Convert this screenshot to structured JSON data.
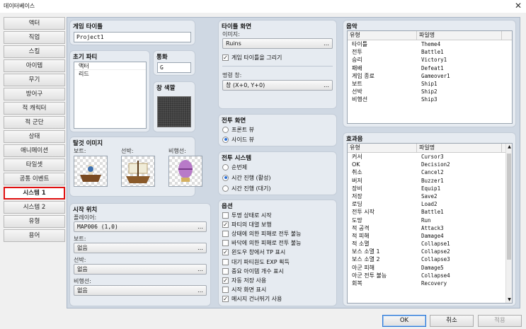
{
  "window": {
    "title": "데이터베이스"
  },
  "sidebar": {
    "items": [
      {
        "label": "액터"
      },
      {
        "label": "직업"
      },
      {
        "label": "스킬"
      },
      {
        "label": "아이템"
      },
      {
        "label": "무기"
      },
      {
        "label": "방어구"
      },
      {
        "label": "적 캐릭터"
      },
      {
        "label": "적 군단"
      },
      {
        "label": "상태"
      },
      {
        "label": "애니메이션"
      },
      {
        "label": "타일셋"
      },
      {
        "label": "공통 이벤트"
      },
      {
        "label": "시스템 1"
      },
      {
        "label": "시스템 2"
      },
      {
        "label": "유형"
      },
      {
        "label": "용어"
      }
    ],
    "selected": "시스템 1"
  },
  "game_title": {
    "label": "게임 타이틀",
    "value": "Project1"
  },
  "party": {
    "label": "초기 파티",
    "members": [
      "액터",
      "리드"
    ]
  },
  "currency": {
    "label": "통화",
    "value": "G"
  },
  "window_color": {
    "label": "창 색깔"
  },
  "vehicle_images": {
    "label": "탈것 이미지",
    "boat": "보트:",
    "ship": "선박:",
    "airship": "비행선:"
  },
  "start_position": {
    "label": "시작 위치",
    "player_label": "플레이어:",
    "player_value": "MAP006 (1,0)",
    "boat_label": "보트:",
    "boat_value": "없음",
    "ship_label": "선박:",
    "ship_value": "없음",
    "airship_label": "비행선:",
    "airship_value": "없음"
  },
  "title_screen": {
    "label": "타이틀 화면",
    "image_label": "이미지:",
    "image_value": "Ruins",
    "draw_title": "게임 타이틀을 그리기",
    "command_label": "명령 창:",
    "command_value": "창 (X+0, Y+0)"
  },
  "battle_screen": {
    "label": "전투 화면",
    "front": "프론트 뷰",
    "side": "사이드 뷰"
  },
  "battle_system": {
    "label": "전투 시스템",
    "turn": "순번제",
    "active": "시간 진행 (활성)",
    "wait": "시간 진행 (대기)"
  },
  "options": {
    "label": "옵션",
    "items": [
      {
        "label": "투명 상태로 시작",
        "checked": false
      },
      {
        "label": "파티의 대열 보행",
        "checked": true
      },
      {
        "label": "상태에 의한 피해로 전투 불능",
        "checked": false
      },
      {
        "label": "바닥에 의한 피해로 전투 불능",
        "checked": false
      },
      {
        "label": "윈도우 창에서 TP 표시",
        "checked": true
      },
      {
        "label": "대기 파티원도 EXP 획득",
        "checked": false
      },
      {
        "label": "중요 아이템 개수 표시",
        "checked": false
      },
      {
        "label": "자동 저장 사용",
        "checked": true
      },
      {
        "label": "시작 화면 표시",
        "checked": false
      },
      {
        "label": "메시지 건너뛰기 사용",
        "checked": true
      }
    ]
  },
  "music": {
    "label": "음악",
    "col_type": "유형",
    "col_file": "파일명",
    "rows": [
      [
        "타이틀",
        "Theme4"
      ],
      [
        "전투",
        "Battle1"
      ],
      [
        "승리",
        "Victory1"
      ],
      [
        "패배",
        "Defeat1"
      ],
      [
        "게임 종료",
        "Gameover1"
      ],
      [
        "보트",
        "Ship1"
      ],
      [
        "선박",
        "Ship2"
      ],
      [
        "비행선",
        "Ship3"
      ]
    ]
  },
  "sfx": {
    "label": "효과음",
    "col_type": "유형",
    "col_file": "파일명",
    "rows": [
      [
        "커서",
        "Cursor3"
      ],
      [
        "OK",
        "Decision2"
      ],
      [
        "취소",
        "Cancel2"
      ],
      [
        "버저",
        "Buzzer1"
      ],
      [
        "장비",
        "Equip1"
      ],
      [
        "저장",
        "Save2"
      ],
      [
        "로딩",
        "Load2"
      ],
      [
        "전투 시작",
        "Battle1"
      ],
      [
        "도망",
        "Run"
      ],
      [
        "적 공격",
        "Attack3"
      ],
      [
        "적 피해",
        "Damage4"
      ],
      [
        "적 소멸",
        "Collapse1"
      ],
      [
        "보스 소멸 1",
        "Collapse2"
      ],
      [
        "보스 소멸 2",
        "Collapse3"
      ],
      [
        "아군 피해",
        "Damage5"
      ],
      [
        "아군 전투 불능",
        "Collapse4"
      ],
      [
        "회복",
        "Recovery"
      ]
    ]
  },
  "footer": {
    "ok": "OK",
    "cancel": "취소",
    "apply": "적용"
  },
  "colors": {
    "accent": "#2a6fd6",
    "selected_border": "#e01010",
    "panel_bg": "#e6ebf1"
  }
}
